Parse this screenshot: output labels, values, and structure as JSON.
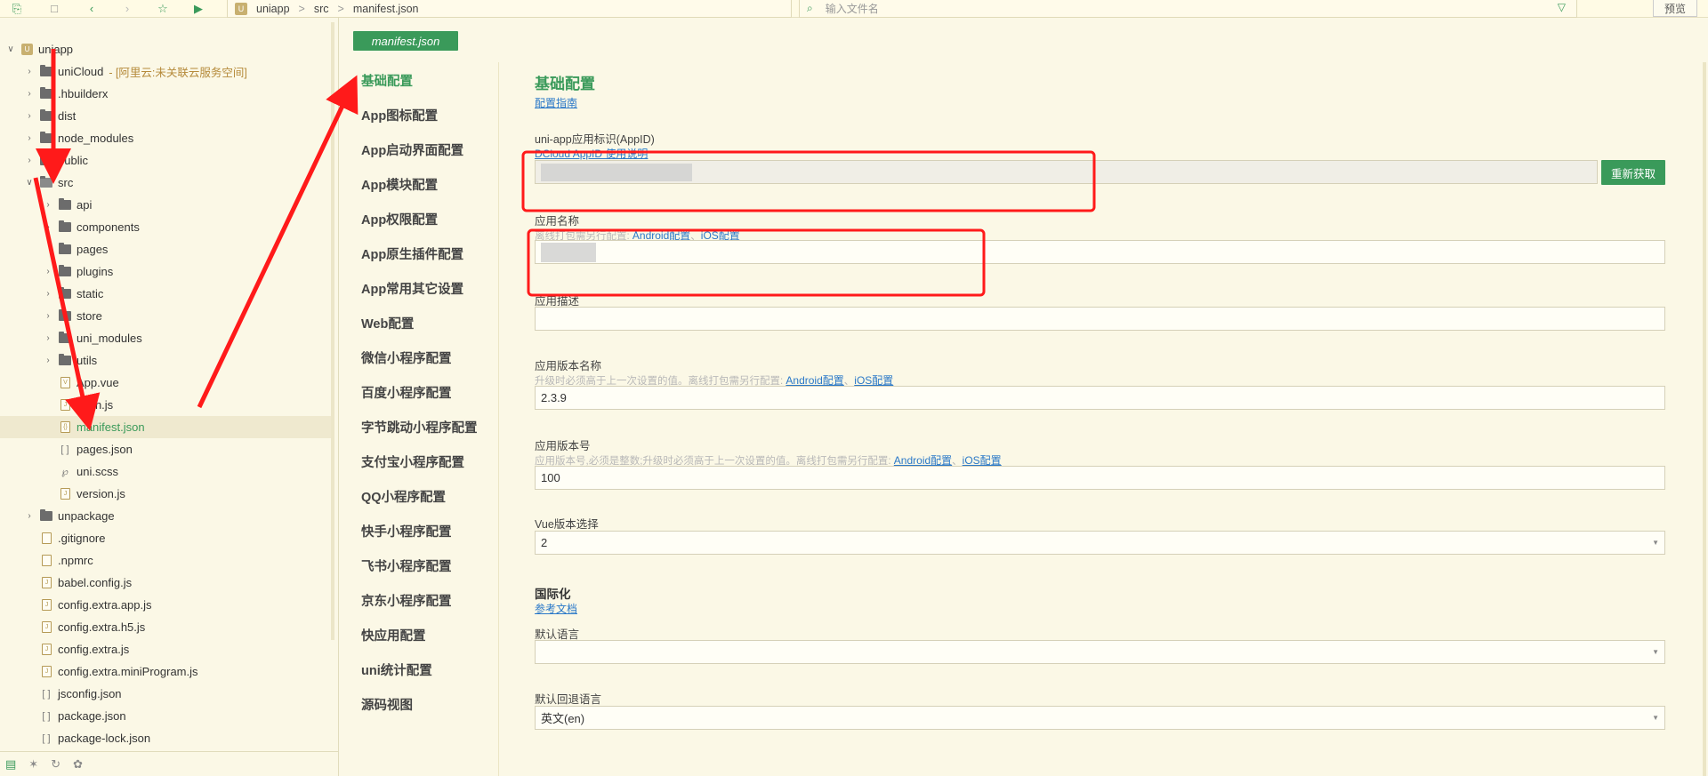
{
  "toolbar": {
    "icons": [
      "new-file-icon",
      "save-icon",
      "back-icon",
      "forward-icon",
      "star-icon",
      "run-icon"
    ]
  },
  "breadcrumb": {
    "items": [
      "uniapp",
      "src",
      "manifest.json"
    ],
    "separator": ">"
  },
  "file_search": {
    "placeholder": "输入文件名"
  },
  "preview_label": "预览",
  "sidebar": {
    "project": "uniapp",
    "items": [
      {
        "label": "uniCloud",
        "note": "- [阿里云:未关联云服务空间]"
      },
      {
        "label": ".hbuilderx"
      },
      {
        "label": "dist"
      },
      {
        "label": "node_modules"
      },
      {
        "label": "public"
      },
      {
        "label": "src"
      },
      {
        "label": "api"
      },
      {
        "label": "components"
      },
      {
        "label": "pages"
      },
      {
        "label": "plugins"
      },
      {
        "label": "static"
      },
      {
        "label": "store"
      },
      {
        "label": "uni_modules"
      },
      {
        "label": "utils"
      },
      {
        "label": "App.vue"
      },
      {
        "label": "main.js"
      },
      {
        "label": "manifest.json"
      },
      {
        "label": "pages.json"
      },
      {
        "label": "uni.scss"
      },
      {
        "label": "version.js"
      },
      {
        "label": "unpackage"
      },
      {
        "label": ".gitignore"
      },
      {
        "label": ".npmrc"
      },
      {
        "label": "babel.config.js"
      },
      {
        "label": "config.extra.app.js"
      },
      {
        "label": "config.extra.h5.js"
      },
      {
        "label": "config.extra.js"
      },
      {
        "label": "config.extra.miniProgram.js"
      },
      {
        "label": "jsconfig.json"
      },
      {
        "label": "package.json"
      },
      {
        "label": "package-lock.json"
      }
    ]
  },
  "tab": {
    "label": "manifest.json"
  },
  "nav": {
    "items": [
      "基础配置",
      "App图标配置",
      "App启动界面配置",
      "App模块配置",
      "App权限配置",
      "App原生插件配置",
      "App常用其它设置",
      "Web配置",
      "微信小程序配置",
      "百度小程序配置",
      "字节跳动小程序配置",
      "支付宝小程序配置",
      "QQ小程序配置",
      "快手小程序配置",
      "飞书小程序配置",
      "京东小程序配置",
      "快应用配置",
      "uni统计配置",
      "源码视图"
    ]
  },
  "form": {
    "title": "基础配置",
    "guide_link": "配置指南",
    "appid": {
      "label": "uni-app应用标识(AppID)",
      "hint": "DCloud AppID 使用说明",
      "value": "",
      "button": "重新获取"
    },
    "app_name": {
      "label": "应用名称",
      "hint": "离线打包需另行配置:",
      "links": [
        "Android配置",
        "iOS配置"
      ],
      "value": ""
    },
    "app_desc": {
      "label": "应用描述",
      "value": ""
    },
    "version_name": {
      "label": "应用版本名称",
      "hint": "升级时必须高于上一次设置的值。离线打包需另行配置:",
      "links": [
        "Android配置",
        "iOS配置"
      ],
      "value": "2.3.9"
    },
    "version_code": {
      "label": "应用版本号",
      "hint": "应用版本号,必须是整数;升级时必须高于上一次设置的值。离线打包需另行配置:",
      "links": [
        "Android配置",
        "iOS配置"
      ],
      "value": "100"
    },
    "vue_version": {
      "label": "Vue版本选择",
      "value": "2"
    },
    "i18n": {
      "title": "国际化",
      "doc_link": "参考文档",
      "default_lang_label": "默认语言",
      "default_lang_value": "",
      "fallback_lang_label": "默认回退语言",
      "fallback_lang_value": "英文(en)"
    }
  },
  "colors": {
    "accent": "#3a9a5a",
    "background": "#fbf8e6",
    "annotation": "#ff1a1a",
    "link": "#2a78c8"
  }
}
